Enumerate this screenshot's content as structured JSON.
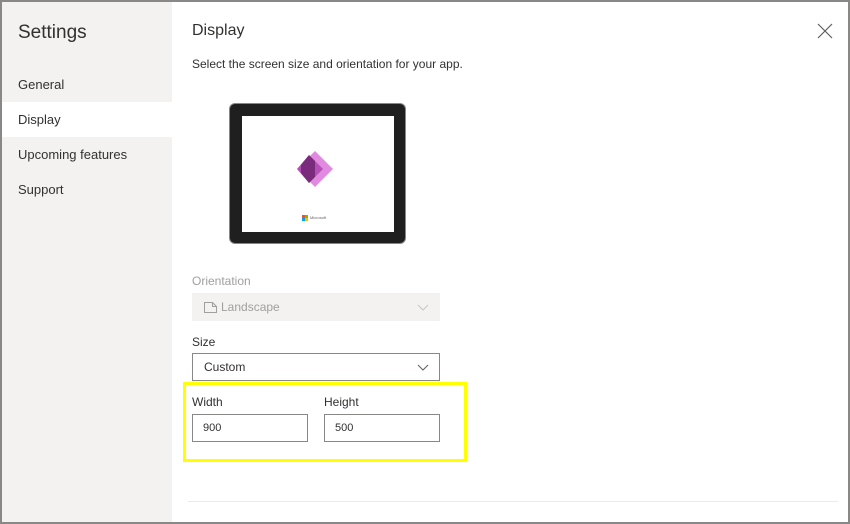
{
  "sidebar": {
    "title": "Settings",
    "items": [
      {
        "label": "General",
        "active": false
      },
      {
        "label": "Display",
        "active": true
      },
      {
        "label": "Upcoming features",
        "active": false
      },
      {
        "label": "Support",
        "active": false
      }
    ]
  },
  "main": {
    "title": "Display",
    "subtitle": "Select the screen size and orientation for your app.",
    "close_icon": "close-icon"
  },
  "preview": {
    "brand_text": "Microsoft",
    "logo_icon": "power-apps-logo-icon",
    "logo_colors": [
      "#742774",
      "#b34fb5",
      "#e08be0"
    ]
  },
  "orientation": {
    "label": "Orientation",
    "value": "Landscape",
    "disabled": true,
    "icon": "landscape-icon"
  },
  "size": {
    "label": "Size",
    "value": "Custom"
  },
  "width": {
    "label": "Width",
    "value": "900"
  },
  "height": {
    "label": "Height",
    "value": "500"
  },
  "colors": {
    "highlight": "#ffff00",
    "sidebar_bg": "#f3f2f1",
    "text": "#323130",
    "disabled_text": "#a19f9d"
  }
}
